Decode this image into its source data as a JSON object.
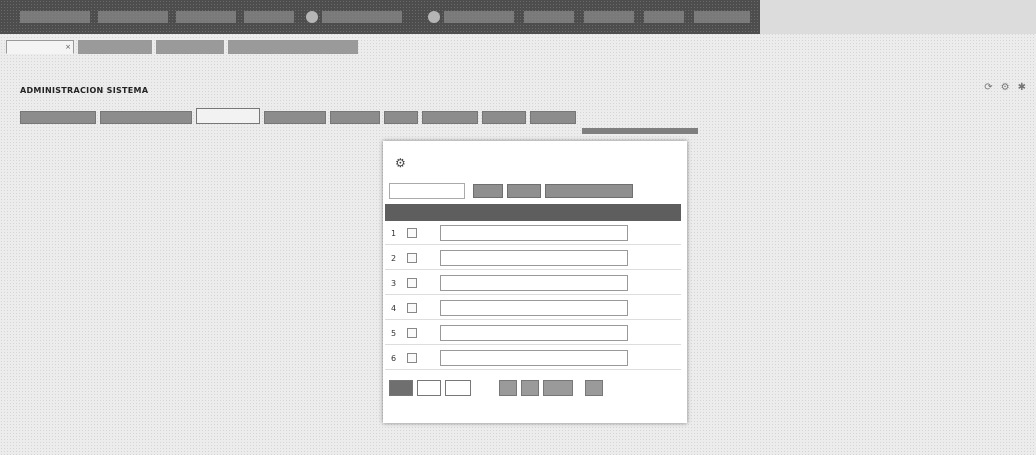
{
  "colors": {
    "topbar": "#4d4d4d",
    "tab": "#9a9a9a",
    "grid_header": "#5e5e5e",
    "page": "#ececec"
  },
  "topbar": {
    "items": [
      "",
      "",
      "",
      "",
      "",
      "",
      "",
      "",
      "",
      ""
    ]
  },
  "tabs": [
    {
      "label": "",
      "active": true,
      "close_icon": "×"
    },
    {
      "label": "",
      "active": false
    },
    {
      "label": "",
      "active": false
    },
    {
      "label": "",
      "active": false
    }
  ],
  "page_header": {
    "title": "ADMINISTRACION SISTEMA",
    "tools": [
      {
        "icon": "refresh-icon",
        "glyph": "⟳"
      },
      {
        "icon": "settings-icon",
        "glyph": "⚙"
      },
      {
        "icon": "gear-icon",
        "glyph": "✱"
      }
    ]
  },
  "subtabs": [
    {
      "label": "",
      "active": false
    },
    {
      "label": "",
      "active": false
    },
    {
      "label": "",
      "active": true
    },
    {
      "label": "",
      "active": false
    },
    {
      "label": "",
      "active": false
    },
    {
      "label": "",
      "active": false
    },
    {
      "label": "",
      "active": false
    },
    {
      "label": "",
      "active": false
    },
    {
      "label": "",
      "active": false
    }
  ],
  "panel": {
    "icon": "users-icon",
    "icon_glyph": "⚙",
    "title": "",
    "search": {
      "value": "",
      "placeholder": ""
    },
    "buttons": [
      "",
      "",
      ""
    ],
    "grid_header": "",
    "rows": [
      {
        "num": "1",
        "text": "",
        "value": ""
      },
      {
        "num": "2",
        "text": "",
        "value": ""
      },
      {
        "num": "3",
        "text": "",
        "value": ""
      },
      {
        "num": "4",
        "text": "",
        "value": ""
      },
      {
        "num": "5",
        "text": "",
        "value": ""
      },
      {
        "num": "6",
        "text": "",
        "value": ""
      }
    ],
    "pager_info": "",
    "status_left": "",
    "status_right": ""
  }
}
